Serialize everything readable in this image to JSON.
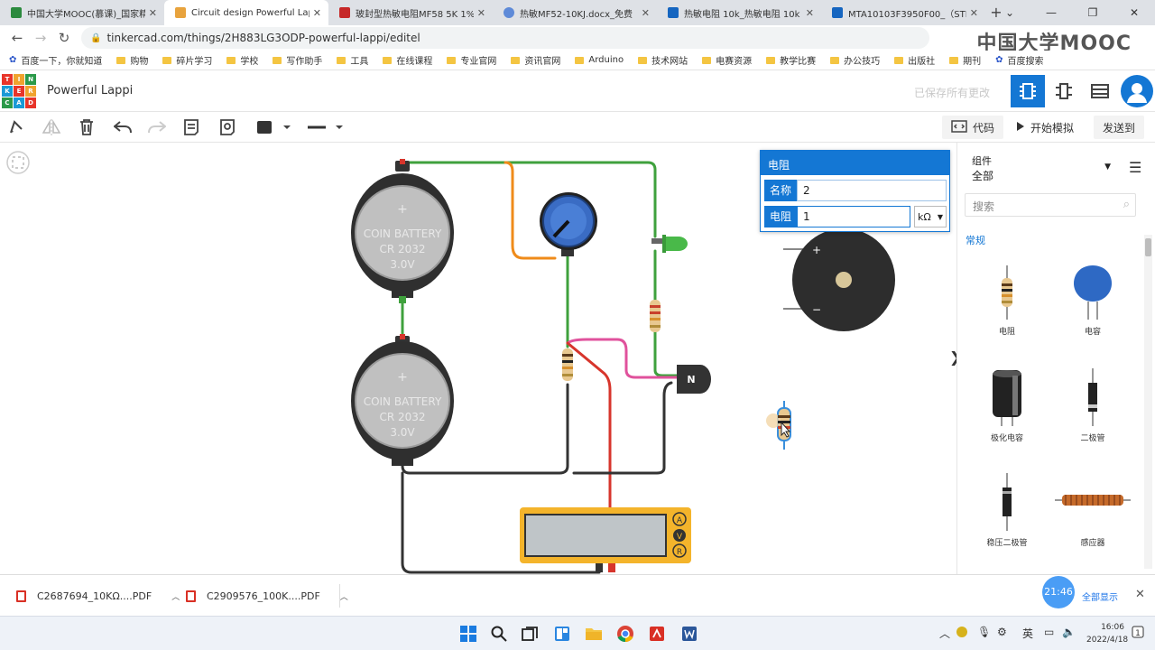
{
  "browser": {
    "tabs": [
      {
        "title": "中国大学MOOC(慕课)_国家精品课程",
        "favicon_color": "#2b8a3e",
        "active": false
      },
      {
        "title": "Circuit design Powerful Lappi",
        "favicon_color": "#e8a33d",
        "active": true
      },
      {
        "title": "玻封型热敏电阻MF58 5K 1%",
        "favicon_color": "#c62828",
        "active": false
      },
      {
        "title": "热敏MF52-10KJ.docx_免费",
        "favicon_color": "#5e8ad8",
        "active": false
      },
      {
        "title": "热敏电阻 10k_热敏电阻 10k",
        "favicon_color": "#1565c0",
        "active": false
      },
      {
        "title": "MTA10103F3950F00_（STE",
        "favicon_color": "#1565c0",
        "active": false
      }
    ],
    "new_tab": "+",
    "window_controls": {
      "minimize": "—",
      "maximize": "❐",
      "close": "✕",
      "dropdown": "⌄"
    },
    "url": "tinkercad.com/things/2H883LG3ODP-powerful-lappi/editel",
    "overlay_logo": "中国大学MOOC",
    "bookmarks": [
      "百度一下，你就知道",
      "购物",
      "碎片学习",
      "学校",
      "写作助手",
      "工具",
      "在线课程",
      "专业官网",
      "资讯官网",
      "Arduino",
      "技术网站",
      "电赛资源",
      "教学比赛",
      "办公技巧",
      "出版社",
      "期刊",
      "百度搜索"
    ]
  },
  "tinkercad": {
    "logo_letters": [
      "T",
      "I",
      "N",
      "K",
      "E",
      "R",
      "C",
      "A",
      "D"
    ],
    "project_title": "Powerful Lappi",
    "save_status": "已保存所有更改",
    "toolbar": {
      "code_label": "代码",
      "simulate_label": "开始模拟",
      "send_label": "发送到"
    },
    "inspector": {
      "title": "电阻",
      "name_label": "名称",
      "name_value": "2",
      "resistance_label": "电阻",
      "resistance_value": "1",
      "unit": "kΩ"
    },
    "component_panel": {
      "category_label": "组件",
      "category_value": "全部",
      "search_placeholder": "搜索",
      "section_title": "常规",
      "items": [
        "电阻",
        "电容",
        "极化电容",
        "二极管",
        "稳压二极管",
        "感应器"
      ]
    },
    "canvas": {
      "battery_label_1": "COIN BATTERY",
      "battery_label_2": "CR 2032",
      "battery_label_3": "3.0V",
      "transistor_label": "N",
      "multimeter_modes": [
        "A",
        "V",
        "R"
      ],
      "buzzer_plus": "+",
      "buzzer_minus": "−"
    }
  },
  "downloads": {
    "items": [
      "C2687694_10KΩ....PDF",
      "C2909576_100K....PDF"
    ],
    "show_all": "全部显示",
    "clock_badge": "21:46"
  },
  "taskbar": {
    "ime": "英",
    "time": "16:06",
    "date": "2022/4/18"
  }
}
